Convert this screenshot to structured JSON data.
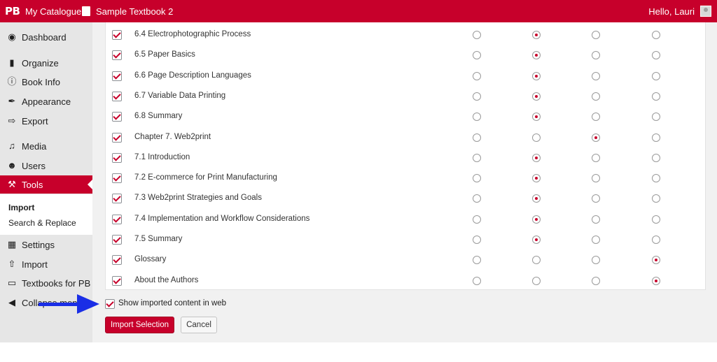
{
  "adminbar": {
    "logo": "PB",
    "catalogue": "My Catalogue",
    "book_title": "Sample Textbook 2",
    "greeting": "Hello, Lauri"
  },
  "sidebar": {
    "items": [
      {
        "label": "Dashboard",
        "icon": "dashboard-icon"
      },
      {
        "label": "Organize",
        "icon": "organize-icon"
      },
      {
        "label": "Book Info",
        "icon": "info-icon"
      },
      {
        "label": "Appearance",
        "icon": "paintbrush-icon"
      },
      {
        "label": "Export",
        "icon": "export-icon"
      },
      {
        "label": "Media",
        "icon": "media-icon"
      },
      {
        "label": "Users",
        "icon": "users-icon"
      },
      {
        "label": "Tools",
        "icon": "wrench-icon",
        "active": true
      },
      {
        "label": "Settings",
        "icon": "settings-icon"
      },
      {
        "label": "Import",
        "icon": "import-icon"
      },
      {
        "label": "Textbooks for PB",
        "icon": "textbooks-icon"
      },
      {
        "label": "Collapse menu",
        "icon": "collapse-icon"
      }
    ],
    "submenu": [
      {
        "label": "Import",
        "current": true
      },
      {
        "label": "Search & Replace",
        "current": false
      }
    ]
  },
  "import_table": {
    "rows": [
      {
        "title": "6.4 Electrophotographic Process",
        "checked": true,
        "selected": 1
      },
      {
        "title": "6.5 Paper Basics",
        "checked": true,
        "selected": 1
      },
      {
        "title": "6.6 Page Description Languages",
        "checked": true,
        "selected": 1
      },
      {
        "title": "6.7 Variable Data Printing",
        "checked": true,
        "selected": 1
      },
      {
        "title": "6.8 Summary",
        "checked": true,
        "selected": 1
      },
      {
        "title": "Chapter 7. Web2print",
        "checked": true,
        "selected": 2
      },
      {
        "title": "7.1 Introduction",
        "checked": true,
        "selected": 1
      },
      {
        "title": "7.2 E-commerce for Print Manufacturing",
        "checked": true,
        "selected": 1
      },
      {
        "title": "7.3 Web2print Strategies and Goals",
        "checked": true,
        "selected": 1
      },
      {
        "title": "7.4 Implementation and Workflow Considerations",
        "checked": true,
        "selected": 1
      },
      {
        "title": "7.5 Summary",
        "checked": true,
        "selected": 1
      },
      {
        "title": "Glossary",
        "checked": true,
        "selected": 3
      },
      {
        "title": "About the Authors",
        "checked": true,
        "selected": 3
      }
    ]
  },
  "options": {
    "show_in_web_label": "Show imported content in web"
  },
  "actions": {
    "import_label": "Import Selection",
    "cancel_label": "Cancel"
  },
  "colors": {
    "brand": "#c7002b",
    "annotation_arrow": "#1a2ee6"
  }
}
